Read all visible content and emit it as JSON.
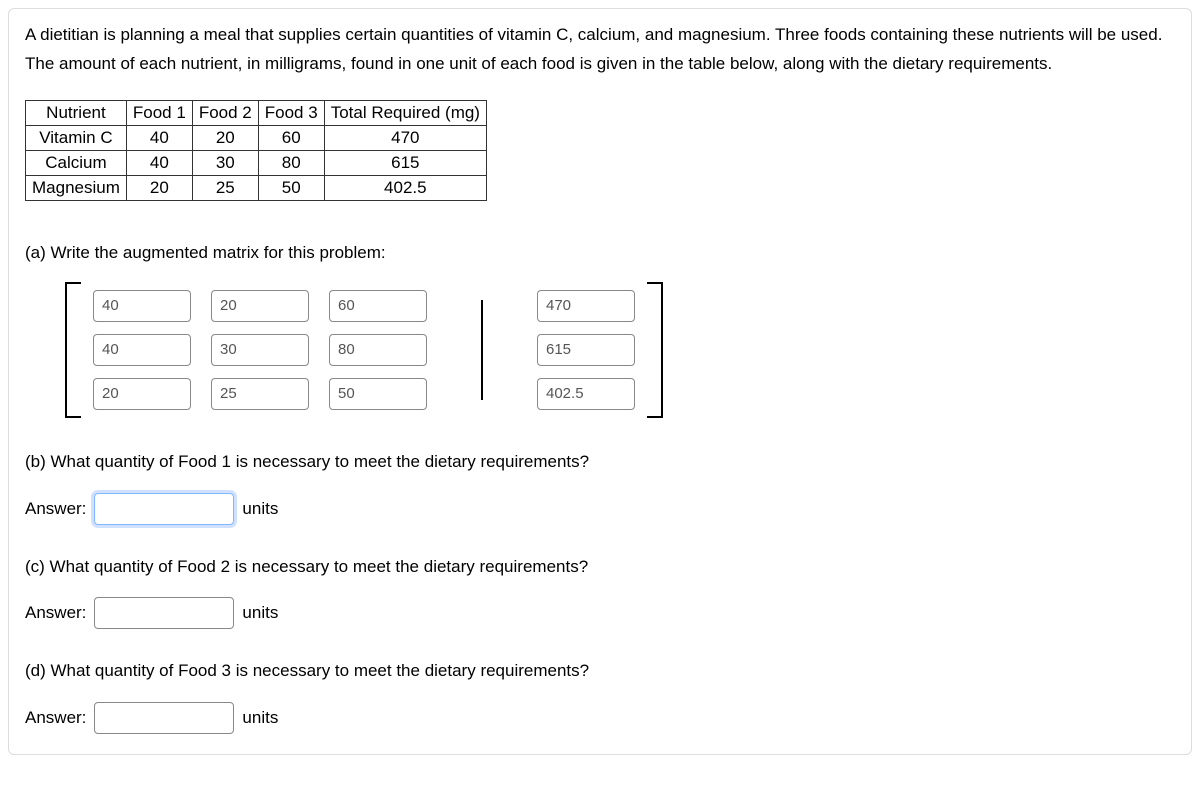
{
  "intro": {
    "line1": "A dietitian is planning a meal that supplies certain quantities of vitamin C, calcium, and magnesium. Three foods containing these nutrients will be used.",
    "line2": "The amount of each nutrient, in milligrams, found in one unit of each food is given in the table below, along with the dietary requirements."
  },
  "table": {
    "headers": [
      "Nutrient",
      "Food 1",
      "Food 2",
      "Food 3",
      "Total Required (mg)"
    ],
    "rows": [
      {
        "nutrient": "Vitamin C",
        "f1": "40",
        "f2": "20",
        "f3": "60",
        "total": "470"
      },
      {
        "nutrient": "Calcium",
        "f1": "40",
        "f2": "30",
        "f3": "80",
        "total": "615"
      },
      {
        "nutrient": "Magnesium",
        "f1": "20",
        "f2": "25",
        "f3": "50",
        "total": "402.5"
      }
    ]
  },
  "part_a": {
    "prompt": "(a) Write the augmented matrix for this problem:",
    "matrix": [
      [
        "40",
        "20",
        "60"
      ],
      [
        "40",
        "30",
        "80"
      ],
      [
        "20",
        "25",
        "50"
      ]
    ],
    "augmented": [
      "470",
      "615",
      "402.5"
    ]
  },
  "part_b": {
    "prompt": "(b) What quantity of Food 1 is necessary to meet the dietary requirements?",
    "answer_label": "Answer:",
    "value": "",
    "units": "units"
  },
  "part_c": {
    "prompt": "(c) What quantity of Food 2 is necessary to meet the dietary requirements?",
    "answer_label": "Answer:",
    "value": "",
    "units": "units"
  },
  "part_d": {
    "prompt": "(d) What quantity of Food 3 is necessary to meet the dietary requirements?",
    "answer_label": "Answer:",
    "value": "",
    "units": "units"
  }
}
